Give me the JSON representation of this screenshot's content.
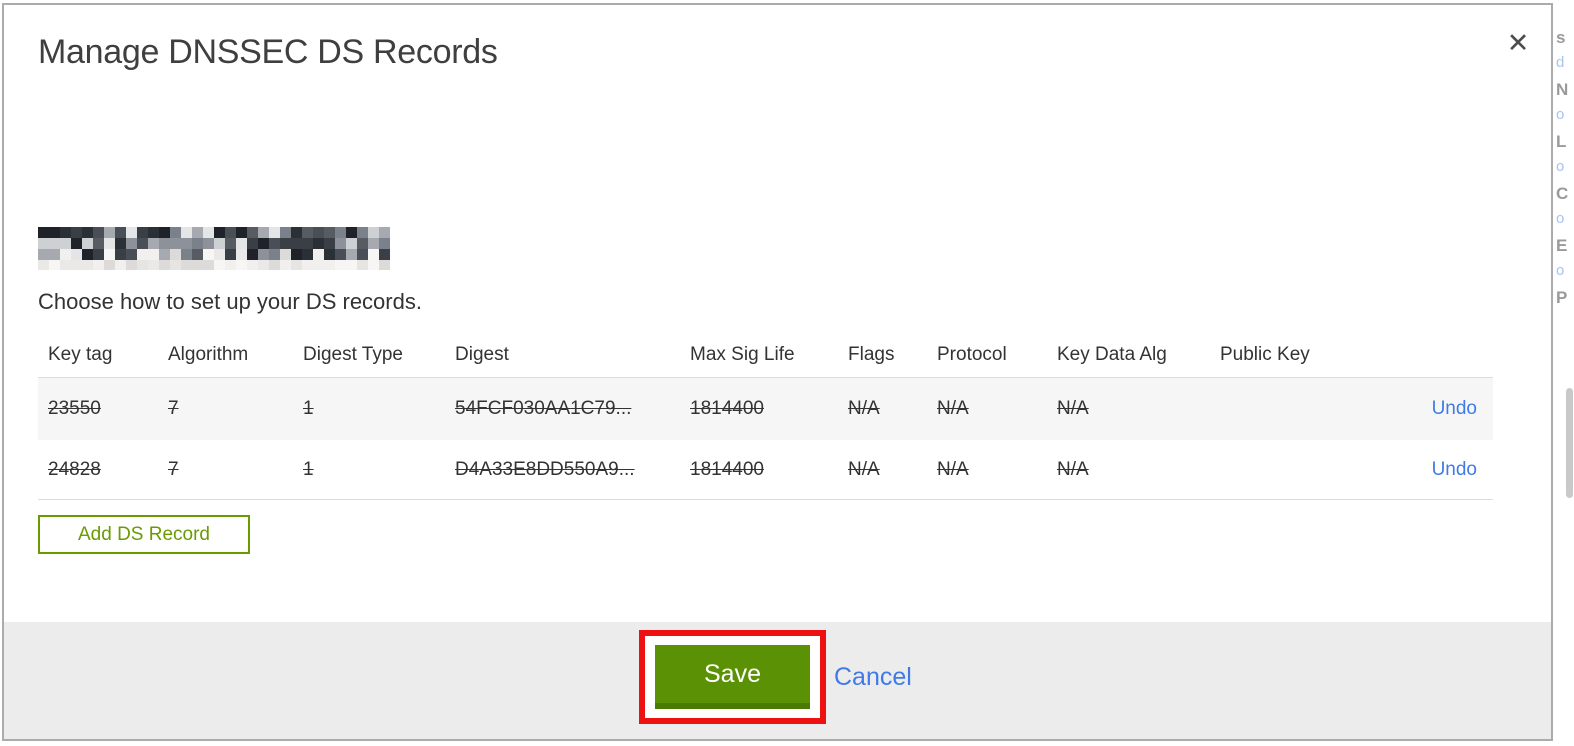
{
  "modal": {
    "title": "Manage DNSSEC DS Records",
    "close_glyph": "✕",
    "domain": {
      "redacted": true,
      "palette": [
        "#1f2228",
        "#3a3f46",
        "#575c63",
        "#7b818a",
        "#a6aab0",
        "#ced1d4",
        "#2b3037",
        "#4a4f57",
        "#8d929a",
        "#e4e5e7"
      ],
      "palette_light": [
        "#f2f0ee",
        "#e7e5e2",
        "#dcdbd9",
        "#f7f6f5",
        "#ebe9e7"
      ]
    },
    "subtitle": "Choose how to set up your DS records.",
    "table": {
      "columns": [
        "Key tag",
        "Algorithm",
        "Digest Type",
        "Digest",
        "Max Sig Life",
        "Flags",
        "Protocol",
        "Key Data Alg",
        "Public Key"
      ],
      "rows": [
        {
          "cells": [
            "23550",
            "7",
            "1",
            "54FCF030AA1C79...",
            "1814400",
            "N/A",
            "N/A",
            "N/A",
            ""
          ],
          "action": "Undo",
          "deleted": true
        },
        {
          "cells": [
            "24828",
            "7",
            "1",
            "D4A33E8DD550A9...",
            "1814400",
            "N/A",
            "N/A",
            "N/A",
            ""
          ],
          "action": "Undo",
          "deleted": true
        }
      ]
    },
    "add_record_label": "Add DS Record",
    "footer": {
      "save_label": "Save",
      "cancel_label": "Cancel"
    }
  },
  "backdrop": {
    "fragments": [
      "s",
      "d",
      "N",
      "o",
      "L",
      "o",
      "C",
      "o",
      "E",
      "o",
      "P"
    ]
  },
  "colors": {
    "save_green": "#5b9104",
    "save_green_dark": "#4b7a03",
    "outline_green": "#6a9b00",
    "link_blue": "#3f7be8",
    "annotation_red": "#ee1111",
    "footer_gray": "#ececec",
    "row_gray": "#f6f6f6",
    "border_gray": "#dcdcdc",
    "modal_border_gray": "#ababab"
  }
}
